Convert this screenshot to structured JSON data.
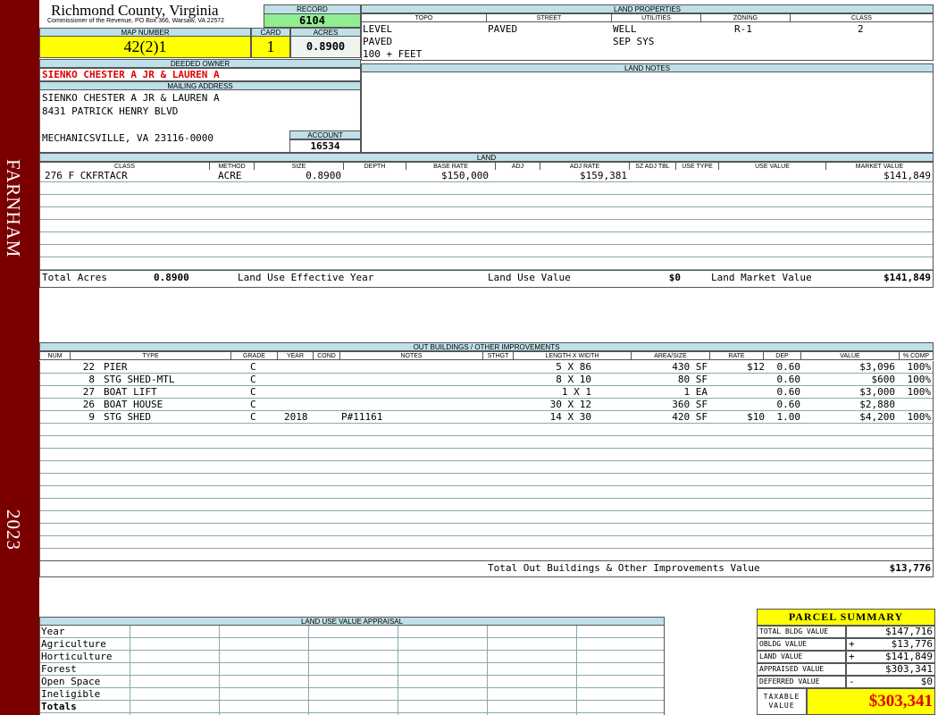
{
  "sidebar": {
    "district": "FARNHAM",
    "year": "2023"
  },
  "header": {
    "county": "Richmond County, Virginia",
    "commissioner": "Commissioner of the Revenue, PO Box 366, Warsaw, VA 22572",
    "record_label": "RECORD",
    "record": "6104",
    "map_label": "MAP NUMBER",
    "map_number": "42(2)1",
    "card_label": "CARD",
    "card": "1",
    "acres_label": "ACRES",
    "acres": "0.8900"
  },
  "owner": {
    "deeded_label": "DEEDED OWNER",
    "deeded": "SIENKO CHESTER A JR & LAUREN A",
    "mailing_label": "MAILING ADDRESS",
    "line1": "SIENKO CHESTER A JR & LAUREN A",
    "line2": "8431 PATRICK HENRY BLVD",
    "line3": "MECHANICSVILLE, VA 23116-0000",
    "account_label": "ACCOUNT",
    "account": "16534"
  },
  "land_properties": {
    "title": "LAND PROPERTIES",
    "headers": [
      "TOPO",
      "STREET",
      "UTILITIES",
      "ZONING",
      "CLASS"
    ],
    "topo": [
      "LEVEL",
      "PAVED",
      "100 + FEET"
    ],
    "street": "PAVED",
    "utilities": [
      "WELL",
      "SEP SYS"
    ],
    "zoning": "R-1",
    "class": "2",
    "notes_label": "LAND NOTES"
  },
  "land": {
    "title": "LAND",
    "headers": [
      "CLASS",
      "METHOD",
      "SIZE",
      "DEPTH",
      "BASE RATE",
      "ADJ",
      "ADJ RATE",
      "SZ ADJ TBL",
      "USE TYPE",
      "USE VALUE",
      "MARKET VALUE"
    ],
    "row": {
      "class": "276 F CKFRTACR",
      "method": "ACRE",
      "size": "0.8900",
      "base_rate": "$150,000",
      "adj_rate": "$159,381",
      "market_value": "$141,849"
    },
    "total_acres_label": "Total Acres",
    "total_acres": "0.8900",
    "effective_year_label": "Land Use Effective Year",
    "use_value_label": "Land Use Value",
    "use_value": "$0",
    "market_value_label": "Land Market Value",
    "market_value": "$141,849"
  },
  "outbuildings": {
    "title": "OUT BUILDINGS / OTHER IMPROVEMENTS",
    "headers": [
      "NUM",
      "TYPE",
      "GRADE",
      "YEAR",
      "COND",
      "NOTES",
      "STHGT",
      "LENGTH X WIDTH",
      "AREA/SIZE",
      "RATE",
      "DEP",
      "VALUE",
      "% COMP"
    ],
    "rows": [
      {
        "num": "22",
        "type": "PIER",
        "grade": "C",
        "year": "",
        "notes": "",
        "lw": "5 X 86",
        "area": "430 SF",
        "rate": "$12",
        "dep": "0.60",
        "value": "$3,096",
        "comp": "100%"
      },
      {
        "num": "8",
        "type": "STG SHED-MTL",
        "grade": "C",
        "year": "",
        "notes": "",
        "lw": "8 X 10",
        "area": "80 SF",
        "rate": "",
        "dep": "0.60",
        "value": "$600",
        "comp": "100%"
      },
      {
        "num": "27",
        "type": "BOAT LIFT",
        "grade": "C",
        "year": "",
        "notes": "",
        "lw": "1 X 1",
        "area": "1 EA",
        "rate": "",
        "dep": "0.60",
        "value": "$3,000",
        "comp": "100%"
      },
      {
        "num": "26",
        "type": "BOAT HOUSE",
        "grade": "C",
        "year": "",
        "notes": "",
        "lw": "30 X 12",
        "area": "360 SF",
        "rate": "",
        "dep": "0.60",
        "value": "$2,880",
        "comp": ""
      },
      {
        "num": "9",
        "type": "STG SHED",
        "grade": "C",
        "year": "2018",
        "notes": "P#11161",
        "lw": "14 X 30",
        "area": "420 SF",
        "rate": "$10",
        "dep": "1.00",
        "value": "$4,200",
        "comp": "100%"
      }
    ],
    "total_label": "Total Out Buildings & Other Improvements Value",
    "total": "$13,776"
  },
  "land_use_appraisal": {
    "title": "LAND USE VALUE APPRAISAL",
    "rows": [
      "Year",
      "Agriculture",
      "Horticulture",
      "Forest",
      "Open Space",
      "Ineligible",
      "Totals"
    ]
  },
  "summary": {
    "title": "PARCEL SUMMARY",
    "rows": [
      {
        "label": "TOTAL BLDG VALUE",
        "sign": "",
        "value": "$147,716"
      },
      {
        "label": "OBLDG VALUE",
        "sign": "+",
        "value": "$13,776"
      },
      {
        "label": "LAND VALUE",
        "sign": "+",
        "value": "$141,849"
      },
      {
        "label": "APPRAISED VALUE",
        "sign": "",
        "value": "$303,341"
      },
      {
        "label": "DEFERRED VALUE",
        "sign": "-",
        "value": "$0"
      }
    ],
    "taxable_label": "TAXABLE VALUE",
    "taxable": "$303,341"
  }
}
